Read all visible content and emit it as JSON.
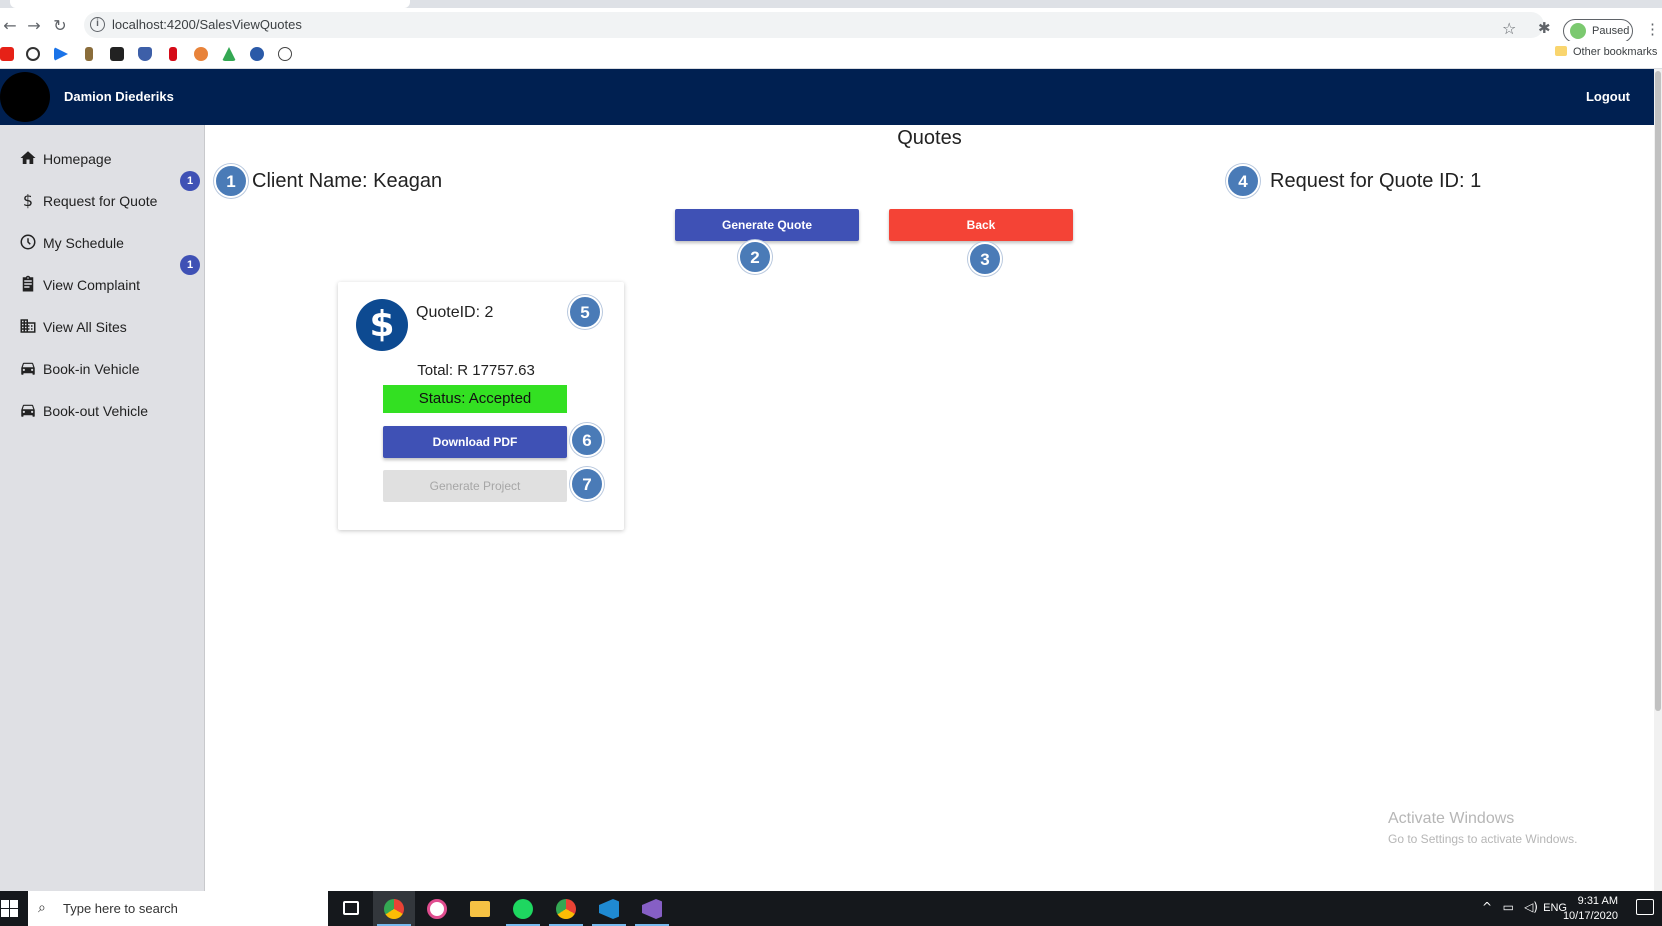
{
  "browser": {
    "url": "localhost:4200/SalesViewQuotes",
    "profile_status": "Paused",
    "other_bookmarks": "Other bookmarks"
  },
  "header": {
    "username": "Damion Diederiks",
    "logout": "Logout"
  },
  "sidebar": {
    "items": [
      {
        "label": "Homepage",
        "icon": "home-icon"
      },
      {
        "label": "Request for Quote",
        "icon": "dollar-icon"
      },
      {
        "label": "My Schedule",
        "icon": "clock-icon"
      },
      {
        "label": "View Complaint",
        "icon": "clipboard-icon"
      },
      {
        "label": "View All Sites",
        "icon": "building-icon"
      },
      {
        "label": "Book-in Vehicle",
        "icon": "car-icon"
      },
      {
        "label": "Book-out Vehicle",
        "icon": "car-icon"
      }
    ],
    "badges": [
      "1",
      "1"
    ]
  },
  "main": {
    "title": "Quotes",
    "client_name": "Client Name: Keagan",
    "request_id": "Request for Quote ID: 1",
    "generate_quote": "Generate Quote",
    "back": "Back",
    "steps": [
      "1",
      "2",
      "3",
      "4",
      "5",
      "6",
      "7"
    ]
  },
  "quote_card": {
    "quote_id": "QuoteID: 2",
    "total": "Total: R 17757.63",
    "status": "Status: Accepted",
    "download_pdf": "Download PDF",
    "generate_project": "Generate Project",
    "currency_symbol": "$"
  },
  "watermark": {
    "line1": "Activate Windows",
    "line2": "Go to Settings to activate Windows."
  },
  "taskbar": {
    "search_placeholder": "Type here to search",
    "language": "ENG",
    "time": "9:31 AM",
    "date": "10/17/2020"
  },
  "colors": {
    "header_bg": "#002051",
    "primary": "#3f51b5",
    "danger": "#f44336",
    "status_accepted": "#33e022",
    "step_badge": "#4a7bb7"
  }
}
